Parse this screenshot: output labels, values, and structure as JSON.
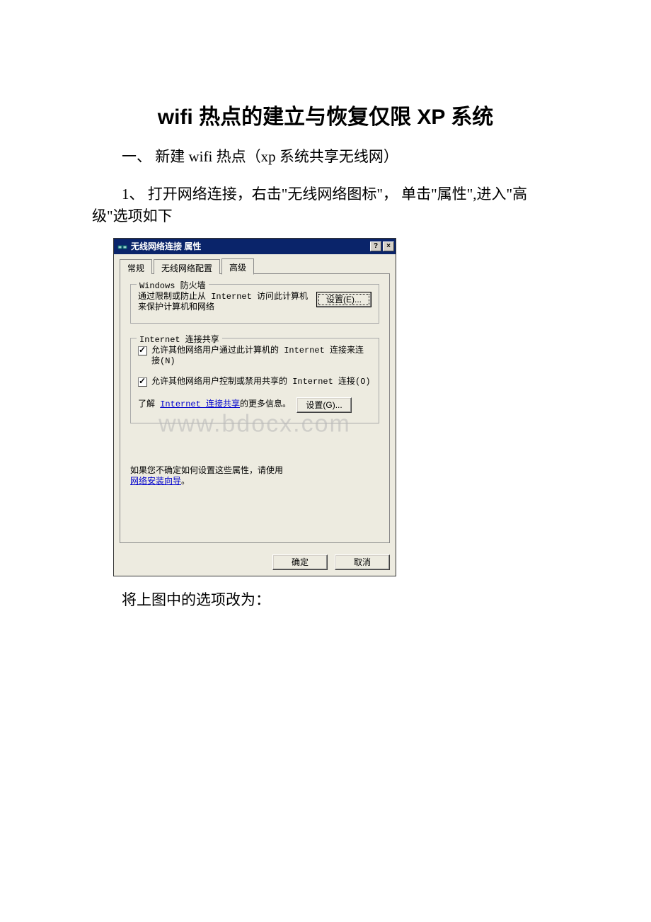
{
  "document": {
    "title": "wifi 热点的建立与恢复仅限 XP 系统",
    "para1": "一、 新建 wifi 热点（xp 系统共享无线网）",
    "para2": "1、 打开网络连接，右击\"无线网络图标\"， 单击\"属性\",进入\"高级\"选项如下",
    "para3": "将上图中的选项改为："
  },
  "dialog": {
    "title": "无线网络连接 属性",
    "help_btn": "?",
    "close_btn": "×",
    "tabs": {
      "general": "常规",
      "wireless": "无线网络配置",
      "advanced": "高级"
    },
    "group1": {
      "legend": "Windows 防火墙",
      "desc": "通过限制或防止从 Internet 访问此计算机来保护计算机和网络",
      "button": "设置(E)..."
    },
    "group2": {
      "legend": "Internet 连接共享",
      "check1": "允许其他网络用户通过此计算机的 Internet 连接来连接(N)",
      "check2": "允许其他网络用户控制或禁用共享的 Internet 连接(O)",
      "learn_prefix": "了解",
      "learn_link": "Internet 连接共享",
      "learn_suffix": "的更多信息。",
      "button": "设置(G)..."
    },
    "help_prefix": "如果您不确定如何设置这些属性，请使用",
    "help_link": "网络安装向导",
    "help_suffix": "。",
    "ok": "确定",
    "cancel": "取消"
  },
  "watermark": "www.bdocx.com"
}
